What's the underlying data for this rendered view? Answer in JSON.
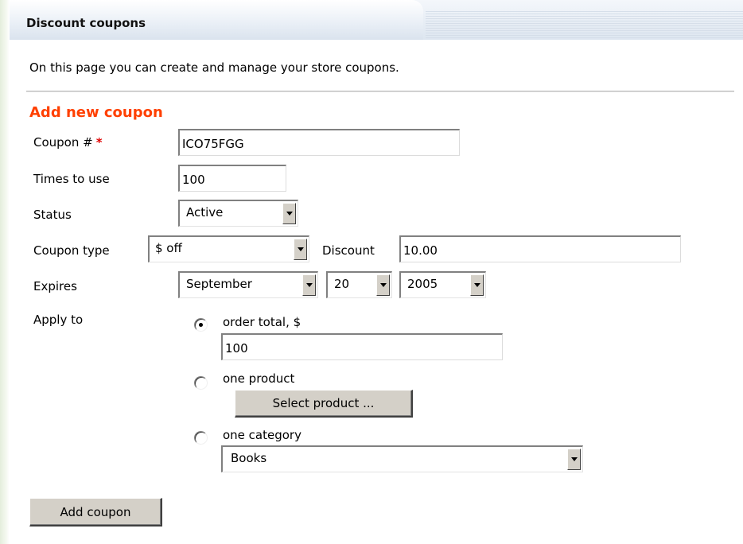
{
  "header": {
    "title": "Discount coupons"
  },
  "intro": "On this page you can create and manage your store coupons.",
  "form": {
    "section_title": "Add new coupon",
    "coupon_number": {
      "label": "Coupon #",
      "required_mark": "*",
      "value": "ICO75FGG"
    },
    "times_to_use": {
      "label": "Times to use",
      "value": "100"
    },
    "status": {
      "label": "Status",
      "selected": "Active"
    },
    "coupon_type": {
      "label": "Coupon type",
      "selected": "$ off"
    },
    "discount": {
      "label": "Discount",
      "value": "10.00"
    },
    "expires": {
      "label": "Expires",
      "month": "September",
      "day": "20",
      "year": "2005"
    },
    "apply_to": {
      "label": "Apply to",
      "options": [
        {
          "label": "order total, $",
          "checked": true,
          "value": "100"
        },
        {
          "label": "one product",
          "checked": false,
          "button": "Select product ..."
        },
        {
          "label": "one category",
          "checked": false,
          "selected": "Books"
        }
      ]
    },
    "submit_label": "Add coupon"
  },
  "colors": {
    "section_title": "#ff4000",
    "required": "#e00000",
    "header_bg": "#dde6f0"
  }
}
